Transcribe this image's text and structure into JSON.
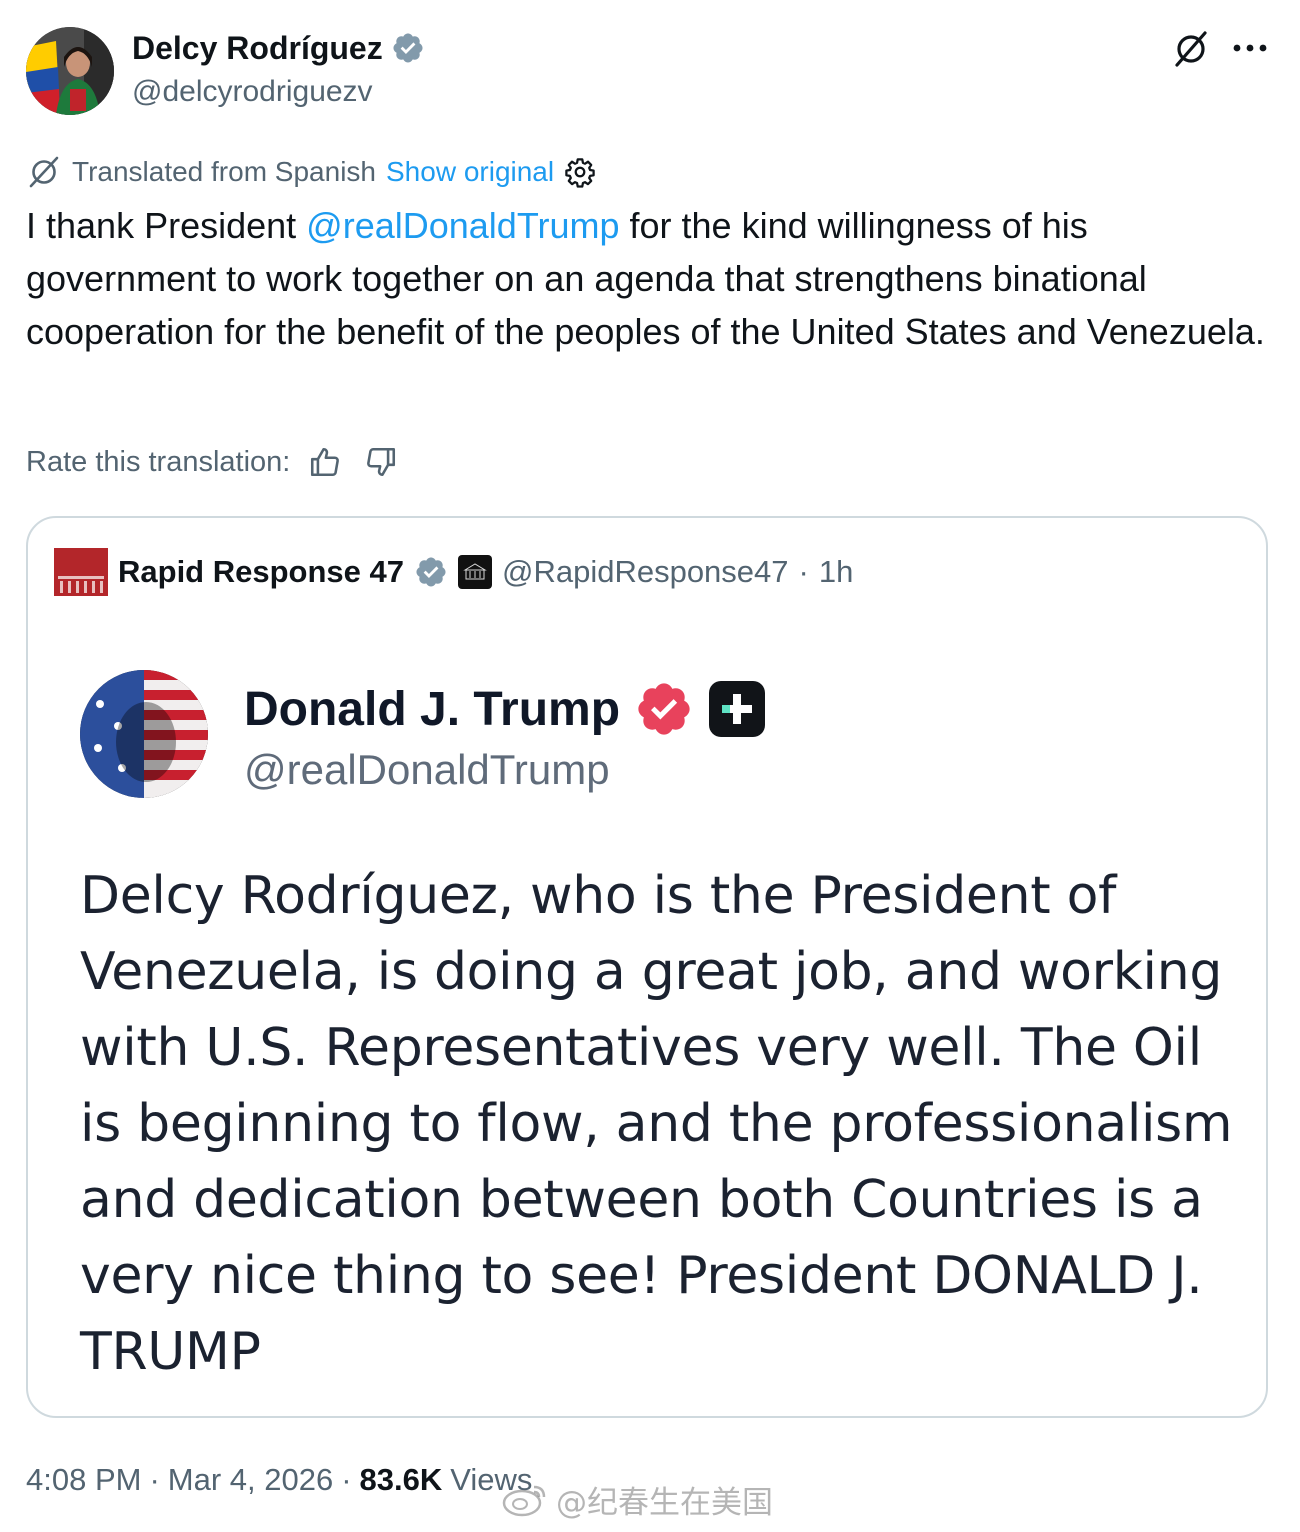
{
  "author": {
    "name": "Delcy Rodríguez",
    "handle": "@delcyrodriguezv"
  },
  "translation": {
    "label": "Translated from Spanish",
    "show_original": "Show original"
  },
  "tweet": {
    "text_before": "I thank President ",
    "mention": "@realDonaldTrump",
    "text_after": " for the kind willingness of his government to work together on an agenda that strengthens binational cooperation for the benefit of the peoples of the United States and Venezuela."
  },
  "rate": {
    "label": "Rate this translation:"
  },
  "quote": {
    "avatar_text": "RAPID RESPONSE",
    "badge_text": "THE WHITE HOUSE",
    "name": "Rapid Response 47",
    "handle": "@RapidResponse47",
    "separator": "·",
    "time": "1h",
    "embed": {
      "name": "Donald J. Trump",
      "handle": "@realDonaldTrump",
      "body": "Delcy Rodríguez, who is the President of Venezuela, is doing a great job, and working with U.S. Representatives very well. The Oil is beginning to flow, and the professionalism and dedication between both Countries is a very nice thing to see! President DONALD J. TRUMP"
    }
  },
  "meta": {
    "time": "4:08 PM",
    "sep1": "·",
    "date": "Mar 4, 2026",
    "sep2": "·",
    "views_count": "83.6K",
    "views_label": "Views"
  },
  "watermark": {
    "text": "@纪春生在美国"
  },
  "colors": {
    "link": "#1d9bf0",
    "verified": "#1d9bf0",
    "verified_gray": "#829aab",
    "truth_verified": "#e8425c",
    "text_secondary": "#536471",
    "border": "#cfd9de"
  },
  "icons": {
    "verified": "verified-badge-icon",
    "grok": "grok-icon",
    "more": "more-icon",
    "translate": "grok-icon",
    "settings": "gear-icon",
    "thumbs_up": "thumbs-up-icon",
    "thumbs_down": "thumbs-down-icon"
  }
}
